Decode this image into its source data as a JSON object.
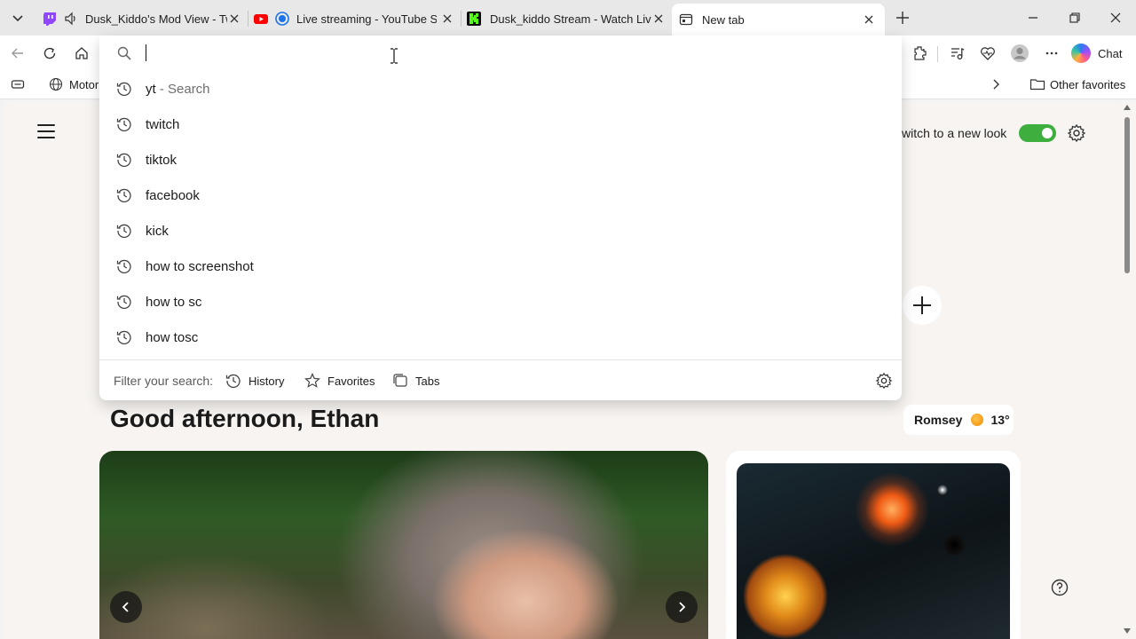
{
  "tabs": [
    {
      "title": "Dusk_Kiddo's Mod View - Twitch",
      "favicon": "twitch-icon",
      "color": "#9146ff"
    },
    {
      "title": "Live streaming - YouTube Studio",
      "favicon": "youtube-icon",
      "color": "#ff0000"
    },
    {
      "title": "Dusk_kiddo Stream - Watch Live on Kick",
      "favicon": "kick-icon",
      "color": "#53fc18"
    },
    {
      "title": "New tab",
      "favicon": "new-tab-icon",
      "active": true
    }
  ],
  "toolbar": {
    "chat_label": "Chat"
  },
  "favorites": {
    "first_item": "Motor",
    "other_favorites": "Other favorites"
  },
  "omnibox": {
    "value": "",
    "suggestions": [
      {
        "text": "yt",
        "hint": " - Search"
      },
      {
        "text": "twitch",
        "hint": ""
      },
      {
        "text": "tiktok",
        "hint": ""
      },
      {
        "text": "facebook",
        "hint": ""
      },
      {
        "text": "kick",
        "hint": ""
      },
      {
        "text": "how to screenshot",
        "hint": ""
      },
      {
        "text": "how to sc",
        "hint": ""
      },
      {
        "text": "how tosc",
        "hint": ""
      }
    ],
    "filter_label": "Filter your search:",
    "filters": [
      "History",
      "Favorites",
      "Tabs"
    ]
  },
  "page": {
    "switch_label": "witch to a new look",
    "greeting": "Good afternoon, Ethan",
    "weather": {
      "location": "Romsey",
      "temp": "13°"
    }
  }
}
